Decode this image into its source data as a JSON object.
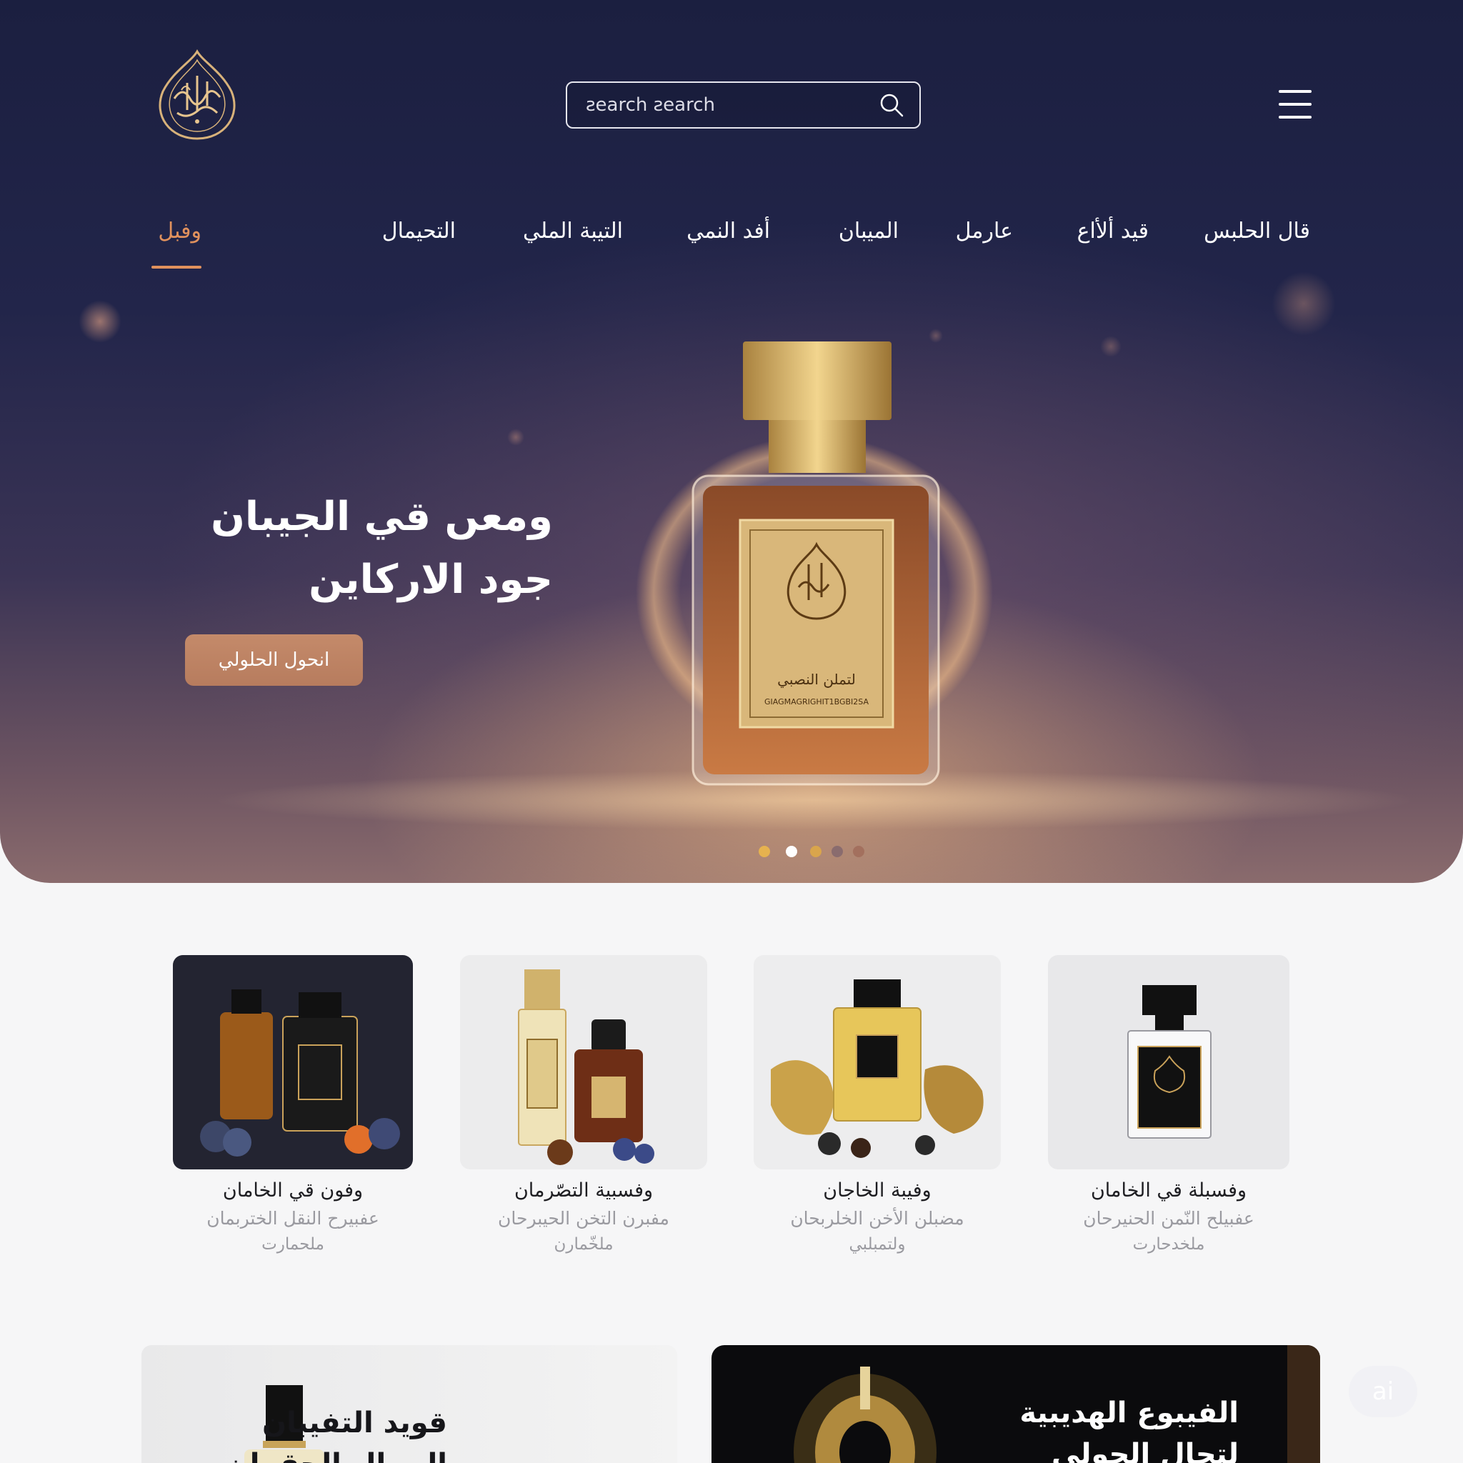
{
  "header": {
    "logo_alt": "Arabic calligraphy logo",
    "search": {
      "placeholder": "ƨearch ƨearch",
      "icon": "search-icon"
    },
    "menu_icon": "hamburger-icon"
  },
  "nav": {
    "items": [
      {
        "label": "قال الحلبس",
        "active": false
      },
      {
        "label": "قيد ألأاع",
        "active": false
      },
      {
        "label": "عارمل",
        "active": false
      },
      {
        "label": "الميبان",
        "active": false
      },
      {
        "label": "أفد النمي",
        "active": false
      },
      {
        "label": "التيبة الملي",
        "active": false
      },
      {
        "label": "التحيمال",
        "active": false
      },
      {
        "label": "وفبل",
        "active": true
      }
    ],
    "accent": "#e0915d"
  },
  "hero": {
    "title_line1": "ومعں قي الجيبان",
    "title_line2": "جود الاركاين",
    "cta_label": "انحول الحلولي",
    "bottle_label_text": "لتملن النصبي",
    "bottle_label_small": "GIAGMAGRIGHIT1BGBI2SA",
    "carousel": {
      "count": 5,
      "active_index": 1
    }
  },
  "products": [
    {
      "name": "وفون قي الخامان",
      "desc": "عفبيرح النقل الختربمان",
      "desc2": "ملحمارت"
    },
    {
      "name": "وفسبية التصّرمان",
      "desc": "مفبرن التخن الحيبرحان",
      "desc2": "ملخّمارن"
    },
    {
      "name": "وفيبة الخاجان",
      "desc": "مضبلن الأخن الخلربحان",
      "desc2": "ولتمبلبي"
    },
    {
      "name": "وفسبلة قي الخامان",
      "desc": "عفبيلح النّمن الحنيرحان",
      "desc2": "ملخدحارت"
    }
  ],
  "promos": [
    {
      "title_line1": "قويد التفيبان",
      "title_line2": "الصبال الحقمان"
    },
    {
      "title_line1": "الفيبوع الهديبية",
      "title_line2": "لتجال الجولي"
    }
  ],
  "chat": {
    "label": "ai"
  }
}
